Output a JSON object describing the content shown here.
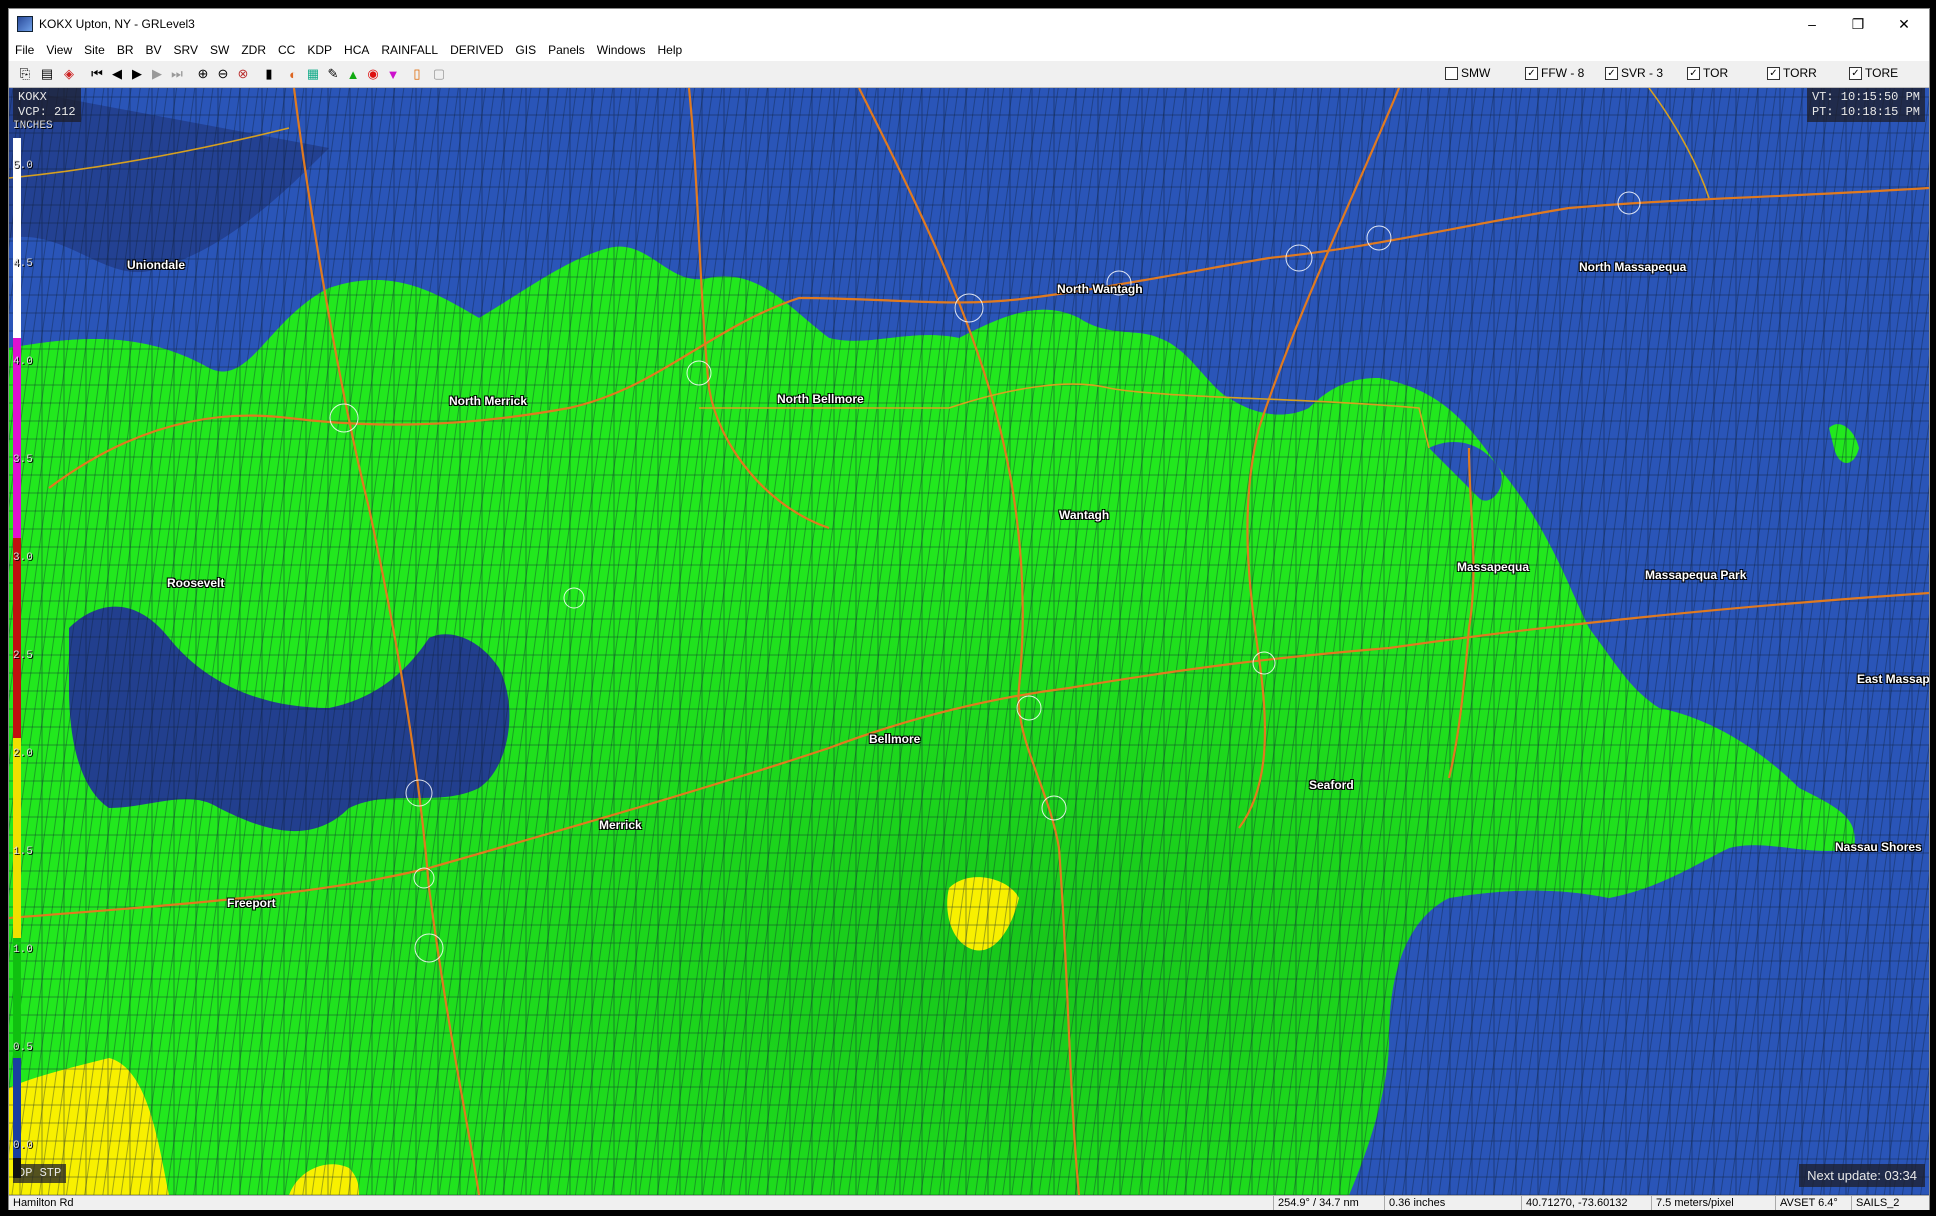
{
  "window": {
    "title": "KOKX Upton, NY - GRLevel3",
    "minimize": "–",
    "maximize": "❐",
    "close": "✕"
  },
  "menu": [
    "File",
    "View",
    "Site",
    "BR",
    "BV",
    "SRV",
    "SW",
    "ZDR",
    "CC",
    "KDP",
    "HCA",
    "RAINFALL",
    "DERIVED",
    "GIS",
    "Panels",
    "Windows",
    "Help"
  ],
  "warnings": [
    {
      "label": "SMW",
      "checked": false
    },
    {
      "label": "FFW - 8",
      "checked": true
    },
    {
      "label": "SVR - 3",
      "checked": true
    },
    {
      "label": "TOR",
      "checked": true
    },
    {
      "label": "TORR",
      "checked": true
    },
    {
      "label": "TORE",
      "checked": true
    }
  ],
  "radar": {
    "site": "KOKX",
    "vcp": "VCP: 212",
    "vt": "VT: 10:15:50 PM",
    "pt": "PT: 10:18:15 PM",
    "product": "DP STP",
    "next_update": "Next update: 03:34",
    "units": "INCHES",
    "scale_ticks": [
      "5.0",
      "4.5",
      "4.0",
      "3.5",
      "3.0",
      "2.5",
      "2.0",
      "1.5",
      "1.0",
      "0.5",
      "0.0"
    ]
  },
  "cities": [
    {
      "name": "Uniondale"
    },
    {
      "name": "North Wantagh"
    },
    {
      "name": "North Massapequa"
    },
    {
      "name": "North Merrick"
    },
    {
      "name": "North Bellmore"
    },
    {
      "name": "Wantagh"
    },
    {
      "name": "Roosevelt"
    },
    {
      "name": "Massapequa"
    },
    {
      "name": "Massapequa Park"
    },
    {
      "name": "East Massape"
    },
    {
      "name": "Bellmore"
    },
    {
      "name": "Seaford"
    },
    {
      "name": "Merrick"
    },
    {
      "name": "Nassau Shores"
    },
    {
      "name": "Freeport"
    }
  ],
  "status": {
    "road": "Hamilton Rd",
    "azimuth": "254.9° / 34.7 nm",
    "value": "0.36 inches",
    "latlon": "40.71270, -73.60132",
    "resolution": "7.5 meters/pixel",
    "tilt": "AVSET 6.4°",
    "sails": "SAILS_2"
  },
  "colors": {
    "blue": "#2a55b8",
    "dark_blue": "#203f8a",
    "green": "#22e81e",
    "yellow": "#f8f000",
    "road": "#e07a20"
  }
}
